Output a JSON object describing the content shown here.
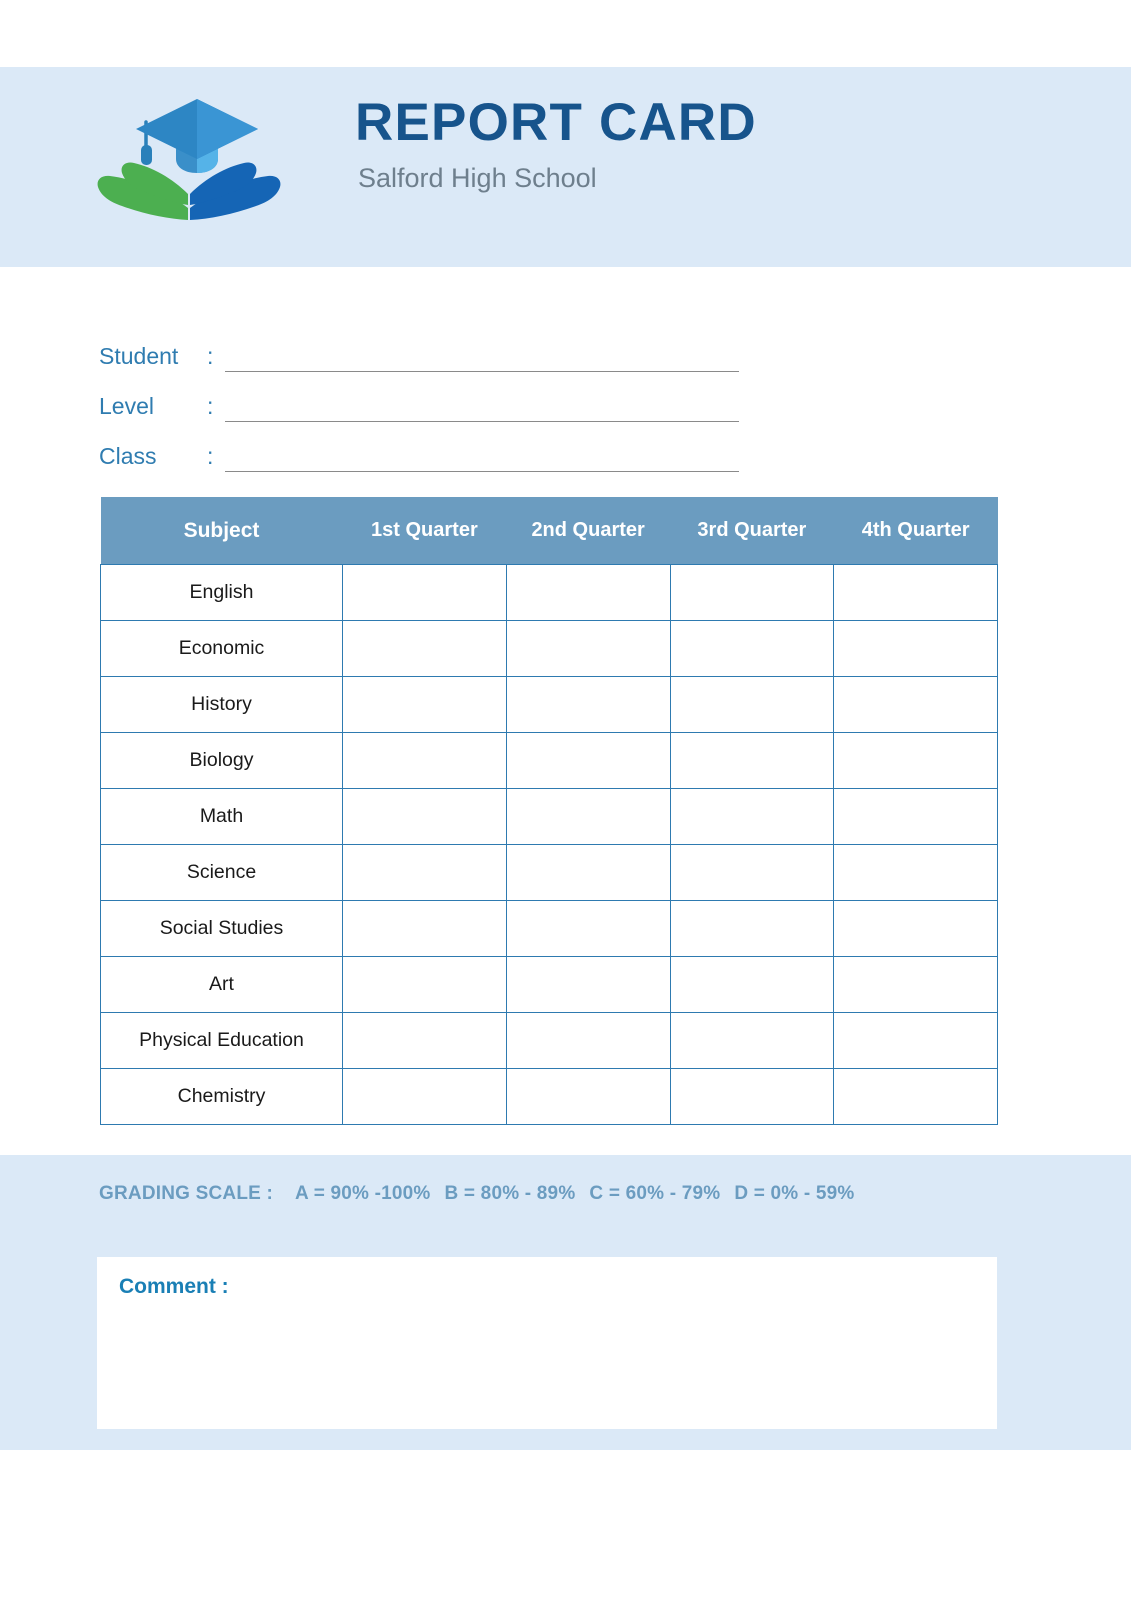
{
  "header": {
    "title": "REPORT CARD",
    "subtitle": "Salford High School",
    "logo_name": "graduation-cap-book-logo",
    "band_color": "#dbe9f7",
    "title_color": "#17548c",
    "subtitle_color": "#6e7f8d"
  },
  "info": {
    "fields": [
      {
        "label": "Student",
        "separator": ":",
        "value": ""
      },
      {
        "label": "Level",
        "separator": ":",
        "value": ""
      },
      {
        "label": "Class",
        "separator": ":",
        "value": ""
      }
    ]
  },
  "table": {
    "headers": [
      "Subject",
      "1st Quarter",
      "2nd Quarter",
      "3rd Quarter",
      "4th Quarter"
    ],
    "header_bg": "#6b9cc0",
    "header_text_color": "#ffffff",
    "border_color": "#2e7ab0",
    "rows": [
      {
        "subject": "English",
        "q1": "",
        "q2": "",
        "q3": "",
        "q4": ""
      },
      {
        "subject": "Economic",
        "q1": "",
        "q2": "",
        "q3": "",
        "q4": ""
      },
      {
        "subject": "History",
        "q1": "",
        "q2": "",
        "q3": "",
        "q4": ""
      },
      {
        "subject": "Biology",
        "q1": "",
        "q2": "",
        "q3": "",
        "q4": ""
      },
      {
        "subject": "Math",
        "q1": "",
        "q2": "",
        "q3": "",
        "q4": ""
      },
      {
        "subject": "Science",
        "q1": "",
        "q2": "",
        "q3": "",
        "q4": ""
      },
      {
        "subject": "Social Studies",
        "q1": "",
        "q2": "",
        "q3": "",
        "q4": ""
      },
      {
        "subject": "Art",
        "q1": "",
        "q2": "",
        "q3": "",
        "q4": ""
      },
      {
        "subject": "Physical Education",
        "q1": "",
        "q2": "",
        "q3": "",
        "q4": ""
      },
      {
        "subject": "Chemistry",
        "q1": "",
        "q2": "",
        "q3": "",
        "q4": ""
      }
    ]
  },
  "footer": {
    "grading_scale_label": "GRADING SCALE :",
    "grading_scale_items": [
      "A = 90% -100%",
      "B = 80% - 89%",
      "C = 60% - 79%",
      "D = 0% - 59%"
    ],
    "grading_scale_color": "#6b9cc0",
    "comment_label": "Comment :",
    "comment_value": "",
    "comment_color": "#1a7fb5",
    "band_color": "#dbe9f7"
  }
}
